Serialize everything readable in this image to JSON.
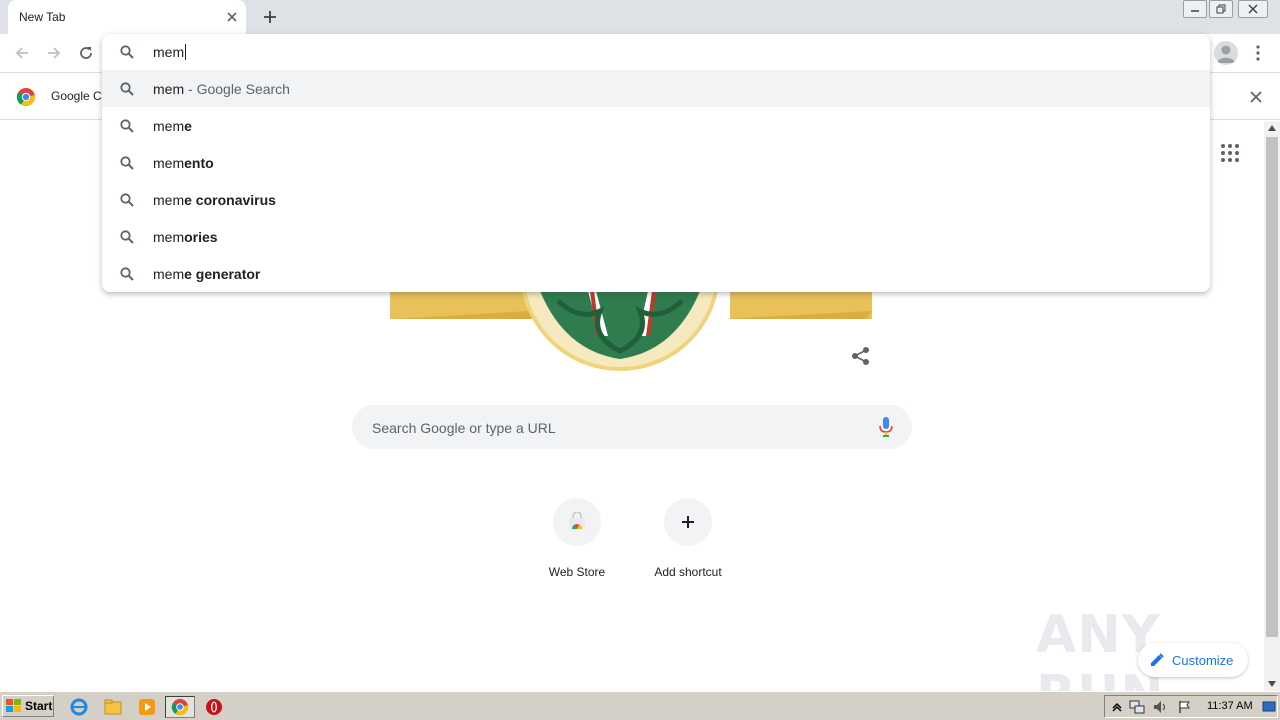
{
  "tab": {
    "title": "New Tab"
  },
  "omnibox": {
    "typed_text": "mem",
    "suggestions": [
      {
        "prefix": "mem",
        "completion": "",
        "description": " - Google Search",
        "selected": true
      },
      {
        "prefix": "mem",
        "completion": "e",
        "description": "",
        "selected": false
      },
      {
        "prefix": "mem",
        "completion": "ento",
        "description": "",
        "selected": false
      },
      {
        "prefix": "mem",
        "completion": "e coronavirus",
        "description": "",
        "selected": false
      },
      {
        "prefix": "mem",
        "completion": "ories",
        "description": "",
        "selected": false
      },
      {
        "prefix": "mem",
        "completion": "e generator",
        "description": "",
        "selected": false
      }
    ]
  },
  "infobar": {
    "text": "Google Cl"
  },
  "ntp": {
    "search_placeholder": "Search Google or type a URL",
    "shortcuts": [
      {
        "label": "Web Store",
        "icon": "webstore-icon"
      },
      {
        "label": "Add shortcut",
        "icon": "plus-icon"
      }
    ],
    "customize_label": "Customize",
    "watermark": "ANY RUN"
  },
  "taskbar": {
    "start_label": "Start",
    "clock": "11:37 AM"
  },
  "colors": {
    "tabstrip_bg": "#dee1e6",
    "accent_blue": "#1a73e8",
    "selected_row": "#f1f3f4",
    "taskbar_bg": "#d4d0c8"
  }
}
